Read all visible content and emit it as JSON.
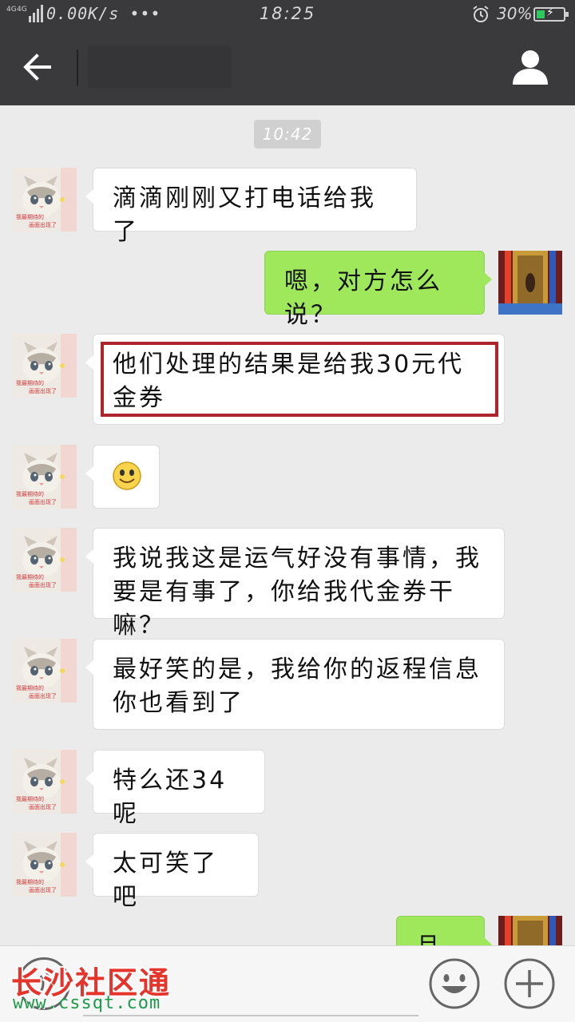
{
  "status_bar": {
    "network_type": "4G 4G",
    "speed": "0.00K/s",
    "more": "•••",
    "time": "18:25",
    "battery": "30%",
    "battery_level": 0.3,
    "battery_color": "#2ec95c"
  },
  "header": {
    "back_icon": "arrow-left-icon",
    "profile_icon": "person-icon",
    "background": "#3a3a3c"
  },
  "chat": {
    "timestamp": "10:42",
    "messages": [
      {
        "side": "left",
        "text": "滴滴刚刚又打电话给我了"
      },
      {
        "side": "right",
        "text": "嗯，对方怎么说？"
      },
      {
        "side": "left",
        "text": "他们处理的结果是给我30元代金券"
      },
      {
        "side": "left",
        "text": "☺"
      },
      {
        "side": "left",
        "text": "我说我这是运气好没有事情，我要是有事了，你给我代金券干嘛？"
      },
      {
        "side": "left",
        "text": "最好笑的是，我给你的返程信息你也看到了"
      },
      {
        "side": "left",
        "text": "特么还34呢"
      },
      {
        "side": "left",
        "text": "太可笑了吧"
      },
      {
        "side": "right",
        "text": "且凉"
      }
    ],
    "avatar_caption_line1": "我最期待的",
    "avatar_caption_line2": "画面出现了",
    "left_bubble_color": "#ffffff",
    "right_bubble_color": "#9fe85c"
  },
  "input_bar": {
    "voice_icon": "voice-icon",
    "emoji_icon": "smiley-icon",
    "plus_icon": "plus-icon"
  },
  "watermark": {
    "title": "长沙社区通",
    "url": "www.cssqt.com"
  }
}
